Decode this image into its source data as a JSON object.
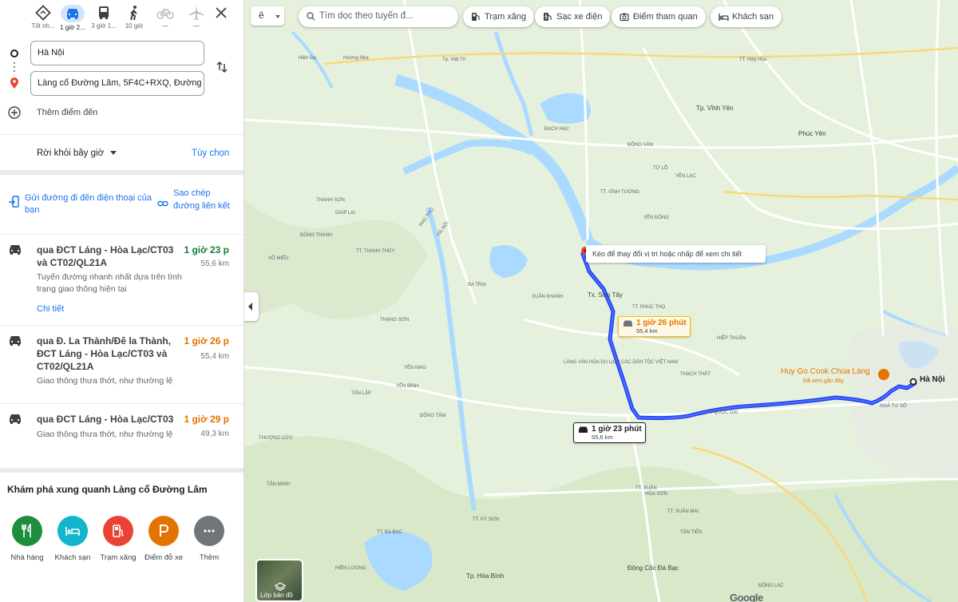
{
  "modes": [
    {
      "name": "best",
      "label": "Tốt nh..."
    },
    {
      "name": "car",
      "label": "1 giờ 2..."
    },
    {
      "name": "bus",
      "label": "3 giờ 1..."
    },
    {
      "name": "walk",
      "label": "10 giờ"
    },
    {
      "name": "bike",
      "label": "—"
    },
    {
      "name": "flight",
      "label": "—"
    }
  ],
  "origin": {
    "value": "Hà Nội"
  },
  "destination": {
    "value": "Làng cổ Đường Lâm, 5F4C+RXQ, Đường"
  },
  "add_destination": "Thêm điểm đến",
  "depart": "Rời khỏi bây giờ",
  "options": "Tùy chọn",
  "send_phone": "Gửi đường đi đến điện thoại của bạn",
  "copy_link": "Sao chép đường liên kết",
  "routes": [
    {
      "title": "qua ĐCT Láng - Hòa Lạc/CT03 và CT02/QL21A",
      "time": "1 giờ 23 p",
      "distance": "55,6 km",
      "desc": "Tuyến đường nhanh nhất dựa trên tình trạng giao thông hiện tại",
      "details": "Chi tiết",
      "time_color": "#188038"
    },
    {
      "title": "qua Đ. La Thành/Đê la Thành, ĐCT Láng - Hòa Lạc/CT03 và CT02/QL21A",
      "time": "1 giờ 26 p",
      "distance": "55,4 km",
      "desc": "Giao thông thưa thớt, như thường lệ",
      "time_color": "#e37400"
    },
    {
      "title": "qua ĐCT Láng - Hòa Lạc/CT03",
      "time": "1 giờ 29 p",
      "distance": "49,3 km",
      "desc": "Giao thông thưa thớt, như thường lệ",
      "time_color": "#e37400"
    }
  ],
  "explore": {
    "title": "Khám phá xung quanh Làng cổ Đường Lâm",
    "items": [
      {
        "label": "Nhà hàng",
        "icon": "restaurant-icon",
        "color": "#1e8e3e"
      },
      {
        "label": "Khách sạn",
        "icon": "hotel-icon",
        "color": "#12b5cb"
      },
      {
        "label": "Trạm xăng",
        "icon": "gas-station-icon",
        "color": "#ea4335"
      },
      {
        "label": "Điểm đỗ xe",
        "icon": "parking-icon",
        "color": "#e37400"
      },
      {
        "label": "Thêm",
        "icon": "more-icon",
        "color": "#70757a"
      }
    ]
  },
  "map": {
    "lang_button": "ê",
    "search_placeholder": "Tìm dọc theo tuyến đ...",
    "chips": [
      {
        "label": "Trạm xăng",
        "icon": "gas-station-icon"
      },
      {
        "label": "Sạc xe điện",
        "icon": "ev-charger-icon"
      },
      {
        "label": "Điểm tham quan",
        "icon": "camera-icon"
      },
      {
        "label": "Khách sạn",
        "icon": "hotel-icon"
      }
    ],
    "drag_tip": "Kéo để thay đổi vị trí hoặc nhấp để xem chi tiết",
    "route_tag_alt": {
      "time": "1 giờ 26 phút",
      "distance": "55,4 km"
    },
    "route_tag_main": {
      "time": "1 giờ 23 phút",
      "distance": "55,6 km"
    },
    "poi": {
      "name": "Huy Go Cook Chùa Láng",
      "sub": "Đã xem gần đây"
    },
    "hanoi": "Hà Nội",
    "layers": "Lớp bản đồ",
    "logo": "Google",
    "colors": {
      "route": "#1a3ef5",
      "water": "#aadaff",
      "land": "#e6f1dd",
      "road": "#ffffff"
    },
    "towns": [
      "Tp. Việt Trì",
      "Hiền Đa",
      "Hương Nha",
      "TT. Hợp Hòa",
      "Tp. Vĩnh Yên",
      "Phúc Yên",
      "BẠCH HẠC",
      "ĐỒNG VĂN",
      "TỬ LỖ",
      "TT. VĨNH TƯỜNG",
      "YÊN LẠC",
      "YÊN ĐỒNG",
      "THANH SƠN",
      "GIÁP LAI",
      "ĐÔNG THÀNH",
      "TT. THANH THỦY",
      "VÕ MIẾU",
      "BA TRẠI",
      "XUÂN KHANH",
      "Tx. Sơn Tây",
      "TT. PHÚC THỌ",
      "HIỆP THUẬN",
      "TT. QUỐC OAI",
      "THẠCH THẤT",
      "YÊN BÌNH",
      "THẠNG SƠN",
      "YÊN MAO",
      "TÂN LẬP",
      "THƯỢNG CỬU",
      "TÂN MINH",
      "HÒA SƠN",
      "TT. XUÂN MAI",
      "TÂN TIẾN",
      "ĐỒNG TÂM",
      "TT. KỲ SƠN",
      "TT. Đà BẠC",
      "Tp. Hòa Bình",
      "HIỀN LƯƠNG",
      "ĐỒNG LẠC",
      "Động Cốc Đá Bạc",
      "NGÃ TƯ SỞ",
      "PHÚ THỌ",
      "HÀ NỘI",
      "TT. XUÂN",
      "LÀNG VĂN HÓA DU LỊCH CÁC DÂN TỘC VIỆT NAM"
    ]
  }
}
